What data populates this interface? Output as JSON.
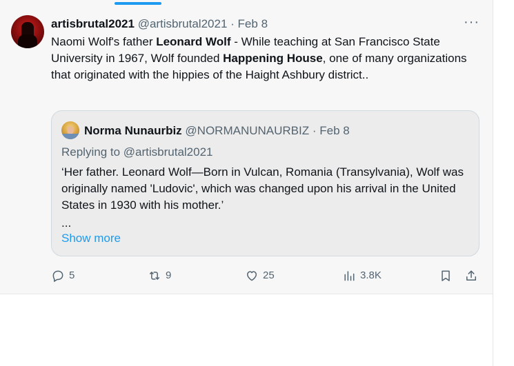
{
  "tweet": {
    "display_name": "artisbrutal2021",
    "handle": "@artisbrutal2021",
    "separator": "·",
    "date": "Feb 8",
    "more_label": "···",
    "text_parts": {
      "p1": "Naomi Wolf's father ",
      "b1": "Leonard Wolf",
      "p2": " - While teaching at San Francisco State University in 1967, Wolf founded ",
      "b2": "Happening House",
      "p3": ", one of many organizations that originated with the hippies of the Haight Ashbury district.."
    }
  },
  "quote": {
    "display_name": "Norma Nunaurbiz",
    "handle": "@NORMANUNAURBIZ",
    "separator": "·",
    "date": "Feb 8",
    "replying_to": "Replying to @artisbrutal2021",
    "text": "‘Her father. Leonard Wolf—Born in Vulcan, Romania (Transylvania), Wolf was originally named 'Ludovic', which was changed upon his arrival in the United States in 1930 with his mother.’",
    "ellipsis": "...",
    "show_more": "Show more"
  },
  "actions": {
    "replies": "5",
    "reposts": "9",
    "likes": "25",
    "views": "3.8K"
  },
  "icons": {
    "reply": "reply-icon",
    "repost": "repost-icon",
    "like": "heart-icon",
    "views": "views-chart-icon",
    "bookmark": "bookmark-icon",
    "share": "share-icon"
  },
  "colors": {
    "accent": "#1d9bf0",
    "text": "#0f1419",
    "muted": "#536471"
  }
}
